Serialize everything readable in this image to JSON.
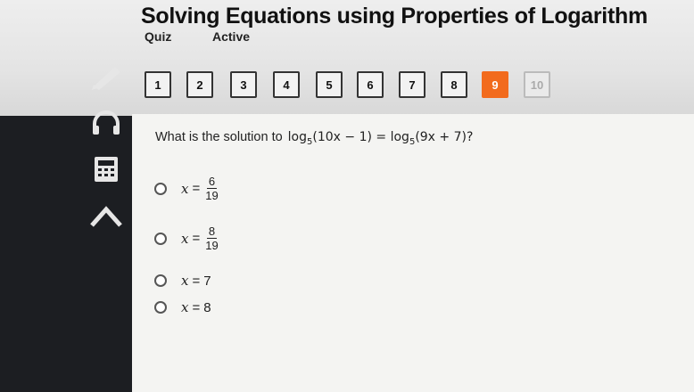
{
  "header": {
    "title": "Solving Equations using Properties of Logarithm",
    "quiz_label": "Quiz",
    "status": "Active"
  },
  "tools": [
    {
      "name": "pencil-icon"
    },
    {
      "name": "headphones-icon"
    },
    {
      "name": "calculator-icon"
    },
    {
      "name": "arrow-up-icon"
    }
  ],
  "question_nav": {
    "items": [
      "1",
      "2",
      "3",
      "4",
      "5",
      "6",
      "7",
      "8",
      "9",
      "10"
    ],
    "current": "9"
  },
  "question": {
    "prompt": "What is the solution to",
    "equation": {
      "lhs_log": "log",
      "lhs_base": "5",
      "lhs_arg": "(10x − 1) = ",
      "rhs_log": "log",
      "rhs_base": "5",
      "rhs_arg": "(9x + 7)?"
    }
  },
  "options": [
    {
      "var": "x",
      "op": "=",
      "num": "6",
      "den": "19"
    },
    {
      "var": "x",
      "op": "=",
      "num": "8",
      "den": "19"
    },
    {
      "var": "x",
      "op": "=",
      "value": "7"
    },
    {
      "var": "x",
      "op": "=",
      "value": "8"
    }
  ],
  "colors": {
    "accent": "#f26b1d",
    "rail": "#1c1e22",
    "panel": "#f4f4f2"
  }
}
